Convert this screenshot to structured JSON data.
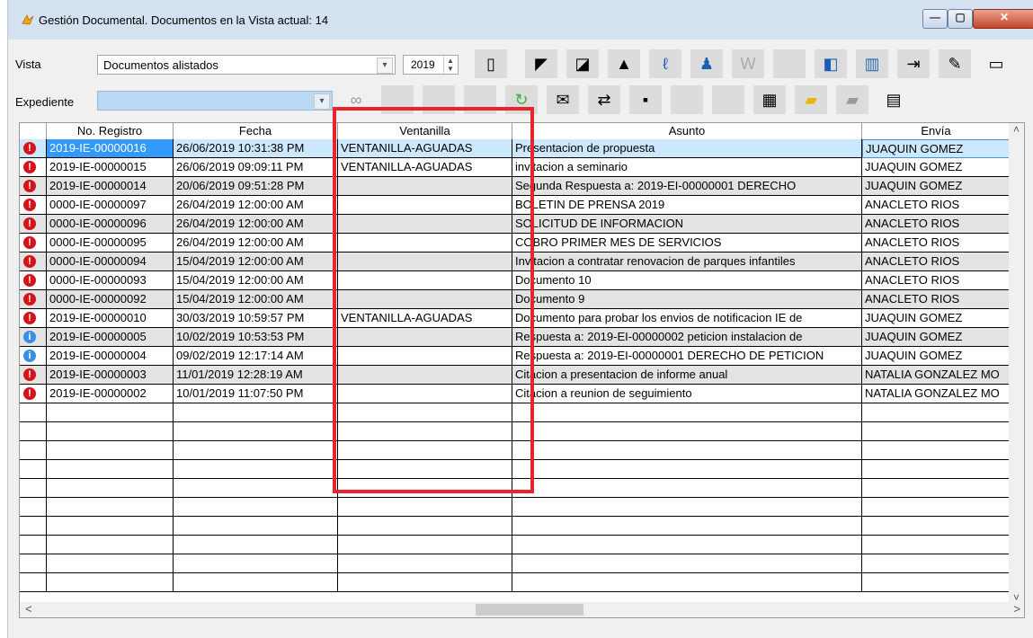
{
  "window": {
    "title": "Gestión Documental. Documentos en la Vista actual: 14",
    "min_glyph": "—",
    "max_glyph": "▢",
    "close_glyph": "✕"
  },
  "filters": {
    "vista_label": "Vista",
    "vista_value": "Documentos alistados",
    "year_value": "2019",
    "expediente_label": "Expediente",
    "expediente_value": ""
  },
  "toolbar_icons": [
    "page-icon",
    "folder-icon",
    "book-icon",
    "user-search-icon",
    "users-icon",
    "signature-icon",
    "page-search-icon",
    "report-icon",
    "export-icon",
    "edit-icon",
    "edit-window-icon",
    "binoculars-icon",
    "recycle-icon",
    "email-icon",
    "transfer-icon",
    "calendar-icon",
    "open-folder-icon",
    "delete-folder-icon",
    "film-icon"
  ],
  "table": {
    "columns": [
      "",
      "No. Registro",
      "Fecha",
      "Ventanilla",
      "Asunto",
      "Envía"
    ],
    "rows": [
      {
        "status": "red",
        "registro": "2019-IE-00000016",
        "fecha": "26/06/2019 10:31:38 PM",
        "ventanilla": "VENTANILLA-AGUADAS",
        "asunto": "Presentacion de propuesta",
        "envia": "JUAQUIN GOMEZ"
      },
      {
        "status": "red",
        "registro": "2019-IE-00000015",
        "fecha": "26/06/2019 09:09:11 PM",
        "ventanilla": "VENTANILLA-AGUADAS",
        "asunto": "invitacion a seminario",
        "envia": "JUAQUIN GOMEZ"
      },
      {
        "status": "red",
        "registro": "2019-IE-00000014",
        "fecha": "20/06/2019 09:51:28 PM",
        "ventanilla": "",
        "asunto": "Segunda Respuesta a: 2019-EI-00000001 DERECHO",
        "envia": "JUAQUIN GOMEZ"
      },
      {
        "status": "red",
        "registro": "0000-IE-00000097",
        "fecha": "26/04/2019 12:00:00 AM",
        "ventanilla": "",
        "asunto": "BOLETIN DE PRENSA 2019",
        "envia": "ANACLETO RIOS"
      },
      {
        "status": "red",
        "registro": "0000-IE-00000096",
        "fecha": "26/04/2019 12:00:00 AM",
        "ventanilla": "",
        "asunto": "SOLICITUD DE INFORMACION",
        "envia": "ANACLETO RIOS"
      },
      {
        "status": "red",
        "registro": "0000-IE-00000095",
        "fecha": "26/04/2019 12:00:00 AM",
        "ventanilla": "",
        "asunto": "COBRO PRIMER MES DE SERVICIOS",
        "envia": "ANACLETO RIOS"
      },
      {
        "status": "red",
        "registro": "0000-IE-00000094",
        "fecha": "15/04/2019 12:00:00 AM",
        "ventanilla": "",
        "asunto": "Invitacion a contratar renovacion de parques infantiles",
        "envia": "ANACLETO RIOS"
      },
      {
        "status": "red",
        "registro": "0000-IE-00000093",
        "fecha": "15/04/2019 12:00:00 AM",
        "ventanilla": "",
        "asunto": "Documento 10",
        "envia": "ANACLETO RIOS"
      },
      {
        "status": "red",
        "registro": "0000-IE-00000092",
        "fecha": "15/04/2019 12:00:00 AM",
        "ventanilla": "",
        "asunto": "Documento 9",
        "envia": "ANACLETO RIOS"
      },
      {
        "status": "red",
        "registro": "2019-IE-00000010",
        "fecha": "30/03/2019 10:59:57 PM",
        "ventanilla": "VENTANILLA-AGUADAS",
        "asunto": "Documento para probar los envios de notificacion IE de",
        "envia": "JUAQUIN GOMEZ"
      },
      {
        "status": "blue",
        "registro": "2019-IE-00000005",
        "fecha": "10/02/2019 10:53:53 PM",
        "ventanilla": "",
        "asunto": "Respuesta a: 2019-EI-00000002 peticion instalacion de",
        "envia": "JUAQUIN GOMEZ"
      },
      {
        "status": "blue",
        "registro": "2019-IE-00000004",
        "fecha": "09/02/2019 12:17:14 AM",
        "ventanilla": "",
        "asunto": "Respuesta a: 2019-EI-00000001 DERECHO DE PETICION",
        "envia": "JUAQUIN GOMEZ"
      },
      {
        "status": "red",
        "registro": "2019-IE-00000003",
        "fecha": "11/01/2019 12:28:19 AM",
        "ventanilla": "",
        "asunto": "Citacion a presentacion de informe anual",
        "envia": "NATALIA GONZALEZ MO"
      },
      {
        "status": "red",
        "registro": "2019-IE-00000002",
        "fecha": "10/01/2019 11:07:50 PM",
        "ventanilla": "",
        "asunto": "Citacion a reunion de seguimiento",
        "envia": "NATALIA GONZALEZ MO"
      }
    ]
  }
}
